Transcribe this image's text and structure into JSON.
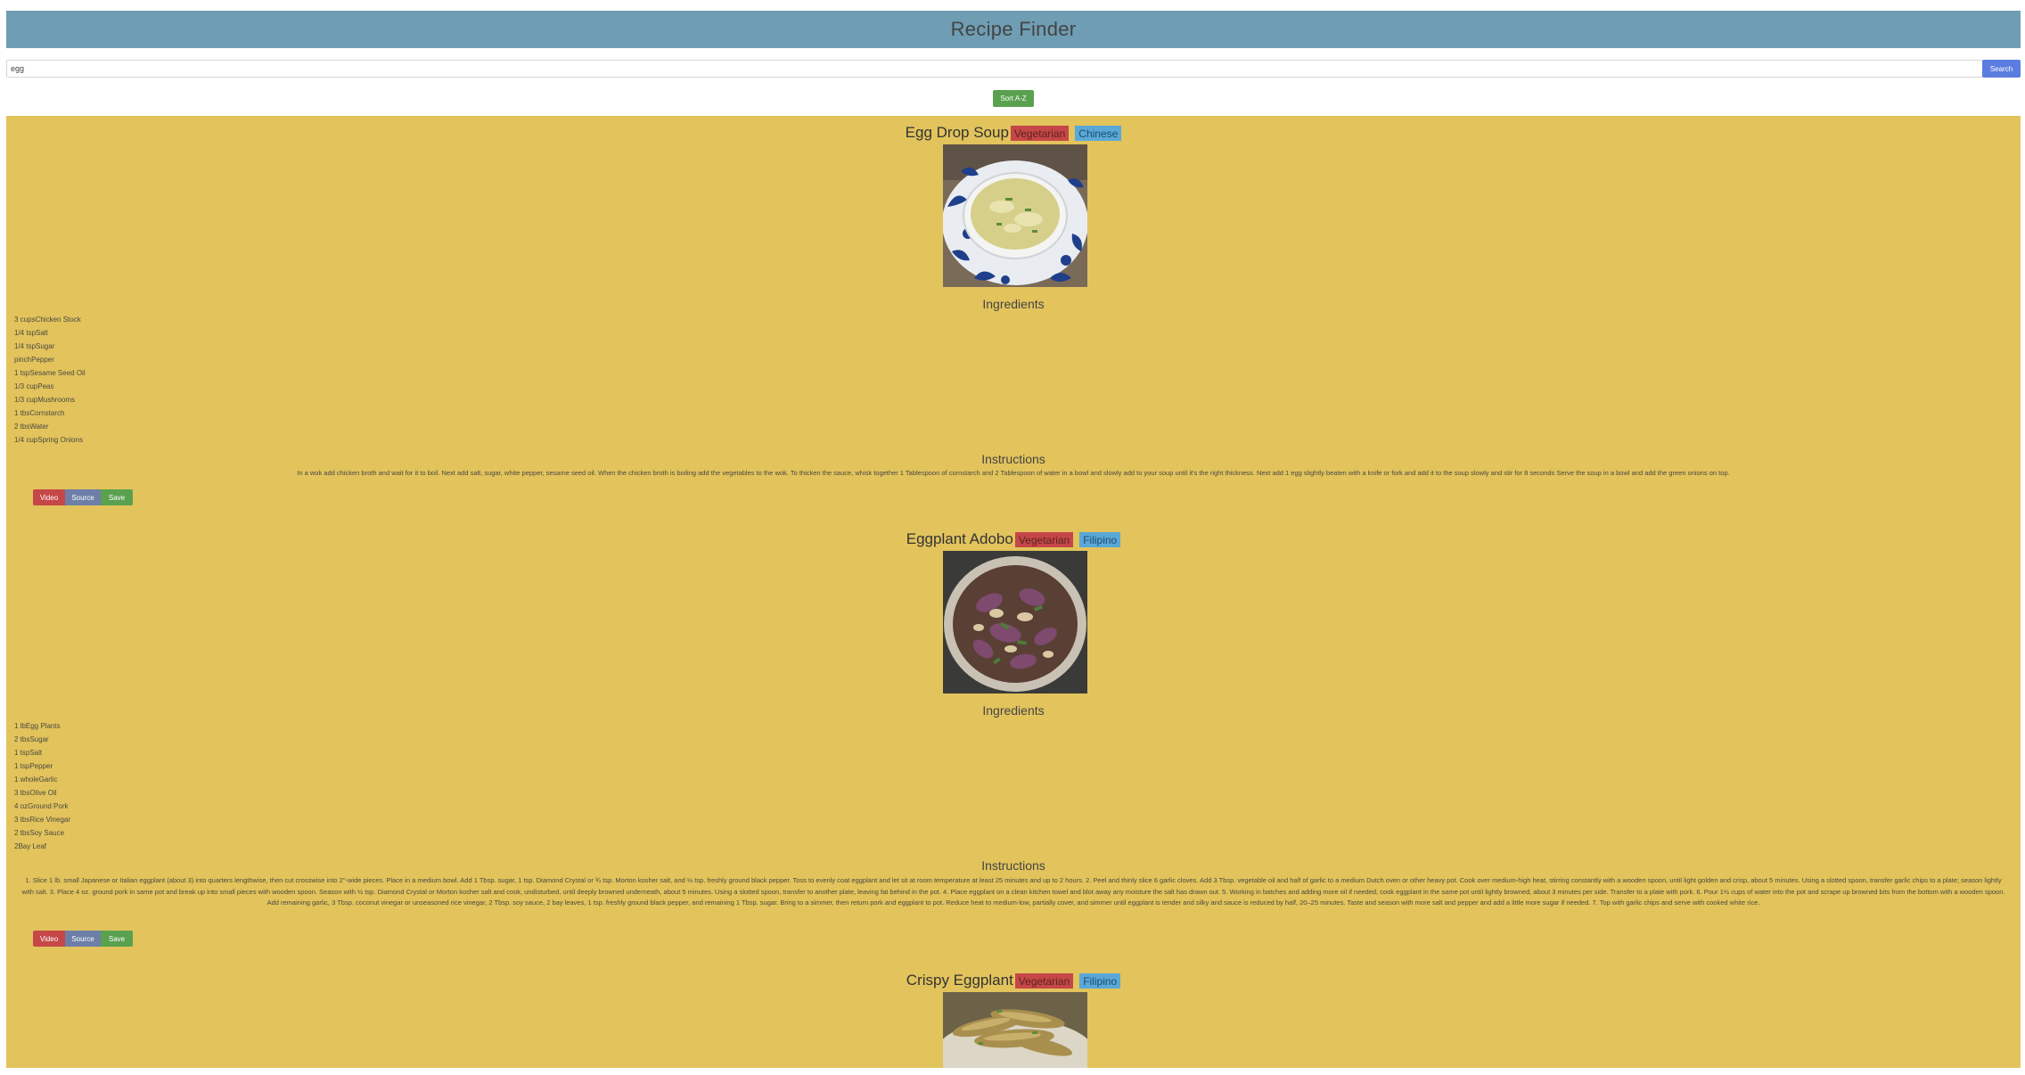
{
  "header": {
    "title": "Recipe Finder"
  },
  "search": {
    "value": "egg",
    "button_label": "Search"
  },
  "sort_label": "Sort A-Z",
  "labels": {
    "ingredients": "Ingredients",
    "instructions": "Instructions"
  },
  "actions": {
    "video": "Video",
    "source": "Source",
    "save": "Save"
  },
  "colors": {
    "header_bg": "#6f9db3",
    "results_bg": "#e2c35c",
    "search_button": "#5b7de0",
    "sort_button": "#5aa14f",
    "tag_diet": "#c64747",
    "tag_cuisine": "#5aa8d8"
  },
  "recipes": [
    {
      "title": "Egg Drop Soup",
      "diet": "Vegetarian",
      "cuisine": "Chinese",
      "image": "egg-drop-soup-photo",
      "ingredients": [
        "3 cupsChicken Stock",
        "1/4 tspSalt",
        "1/4 tspSugar",
        "pinchPepper",
        "1 tspSesame Seed Oil",
        "1/3 cupPeas",
        "1/3 cupMushrooms",
        "1 tbsCornstarch",
        "2 tbsWater",
        "1/4 cupSpring Onions"
      ],
      "instructions": "In a wok add chicken broth and wait for it to boil. Next add salt, sugar, white pepper, sesame seed oil. When the chicken broth is boiling add the vegetables to the wok. To thicken the sauce, whisk together 1 Tablespoon of cornstarch and 2 Tablespoon of water in a bowl and slowly add to your soup until it's the right thickness. Next add 1 egg slightly beaten with a knife or fork and add it to the soup slowly and stir for 8 seconds Serve the soup in a bowl and add the green onions on top."
    },
    {
      "title": "Eggplant Adobo",
      "diet": "Vegetarian",
      "cuisine": "Filipino",
      "image": "eggplant-adobo-photo",
      "ingredients": [
        "1 lbEgg Plants",
        "2 tbsSugar",
        "1 tspSalt",
        "1 tspPepper",
        "1 wholeGarlic",
        "3 tbsOlive Oil",
        "4 ozGround Pork",
        "3 tbsRice Vinegar",
        "2 tbsSoy Sauce",
        "2Bay Leaf"
      ],
      "instructions": "1. Slice 1 lb. small Japanese or Italian eggplant (about 3) into quarters lengthwise, then cut crosswise into 2\"-wide pieces. Place in a medium bowl. Add 1 Tbsp. sugar, 1 tsp. Diamond Crystal or ¾ tsp. Morton kosher salt, and ½ tsp. freshly ground black pepper. Toss to evenly coat eggplant and let sit at room temperature at least 25 minutes and up to 2 hours. 2. Peel and thinly slice 6 garlic cloves. Add 3 Tbsp. vegetable oil and half of garlic to a medium Dutch oven or other heavy pot. Cook over medium-high heat, stirring constantly with a wooden spoon, until light golden and crisp, about 5 minutes. Using a slotted spoon, transfer garlic chips to a plate; season lightly with salt. 3. Place 4 oz. ground pork in same pot and break up into small pieces with wooden spoon. Season with ½ tsp. Diamond Crystal or Morton kosher salt and cook, undisturbed, until deeply browned underneath, about 5 minutes. Using a slotted spoon, transfer to another plate, leaving fat behind in the pot. 4. Place eggplant on a clean kitchen towel and blot away any moisture the salt has drawn out. 5. Working in batches and adding more oil if needed, cook eggplant in the same pot until lightly browned, about 3 minutes per side. Transfer to a plate with pork. 6. Pour 1½ cups of water into the pot and scrape up browned bits from the bottom with a wooden spoon. Add remaining garlic, 3 Tbsp. coconut vinegar or unseasoned rice vinegar, 2 Tbsp. soy sauce, 2 bay leaves, 1 tsp. freshly ground black pepper, and remaining 1 Tbsp. sugar. Bring to a simmer, then return pork and eggplant to pot. Reduce heat to medium-low, partially cover, and simmer until eggplant is tender and silky and sauce is reduced by half, 20–25 minutes. Taste and season with more salt and pepper and add a little more sugar if needed. 7. Top with garlic chips and serve with cooked white rice."
    },
    {
      "title": "Crispy Eggplant",
      "diet": "Vegetarian",
      "cuisine": "Filipino",
      "image": "crispy-eggplant-photo"
    }
  ]
}
